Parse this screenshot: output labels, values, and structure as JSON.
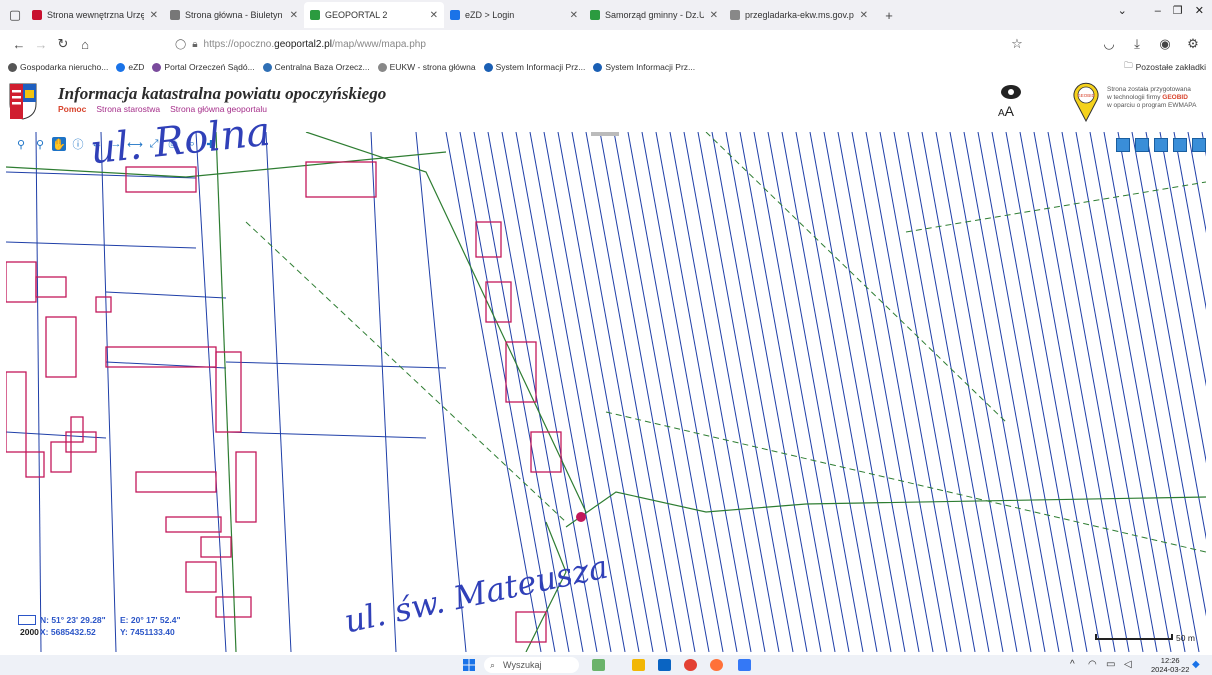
{
  "tabs": [
    {
      "title": "Strona wewnętrzna Urzędu Mi",
      "color": "#c8102e"
    },
    {
      "title": "Strona główna - Biuletyn Infor",
      "color": "#777777"
    },
    {
      "title": "GEOPORTAL 2",
      "color": "#2b9b3f"
    },
    {
      "title": "eZD > Login",
      "color": "#1a73e8"
    },
    {
      "title": "Samorząd gminny - Dz.U. i M.P.",
      "color": "#2b9b3f"
    },
    {
      "title": "przegladarka-ekw.ms.gov.pl/e",
      "color": "#888888"
    }
  ],
  "tab_new": "+",
  "window_controls": {
    "list": "⌄",
    "minimize": "–",
    "restore": "❐",
    "close": "✕"
  },
  "url": {
    "prefix": "https://opoczno.",
    "domain": "geoportal2.pl",
    "path": "/map/www/mapa.php"
  },
  "bookmarks": [
    {
      "label": "Gospodarka nierucho...",
      "color": "#555555"
    },
    {
      "label": "eZD",
      "color": "#1a73e8"
    },
    {
      "label": "Portal Orzeczeń Sądó...",
      "color": "#7a4b9c"
    },
    {
      "label": "Centralna Baza Orzecz...",
      "color": "#2f6fb5"
    },
    {
      "label": "EUKW - strona główna",
      "color": "#888888"
    },
    {
      "label": "System Informacji Prz...",
      "color": "#1a5fb4"
    },
    {
      "label": "System Informacji Prz...",
      "color": "#1a5fb4"
    }
  ],
  "bookmarks_other": "Pozostałe zakładki",
  "app": {
    "title": "Informacja katastralna powiatu opoczyńskiego",
    "links": [
      "Pomoc",
      "Strona starostwa",
      "Strona główna geoportalu"
    ],
    "aa": "A",
    "aa_big": "A",
    "geo_text_lines": [
      "Strona została przygotowana",
      "w technologii firmy",
      "GEOBID",
      "w oparciu o program EWMAPA"
    ],
    "geo_logo": "GEOBID"
  },
  "map": {
    "handwritten_top": "ul. Rolna",
    "handwritten_bottom": "ul. św. Mateusza",
    "coords": {
      "n": "N: 51° 23' 29.28\"",
      "e": "E: 20° 17' 52.4\"",
      "x": "X: 5685432.52",
      "y": "Y: 7451133.40",
      "scale": "2000"
    },
    "scale_label": "50 m",
    "colors": {
      "parcel": "#1f3fa8",
      "building": "#c2185b",
      "road": "#2e7d32",
      "water": "#2a6fe0"
    }
  },
  "taskbar": {
    "search": "Wyszukaj",
    "time": "12:26",
    "date": "2024-03-22"
  }
}
